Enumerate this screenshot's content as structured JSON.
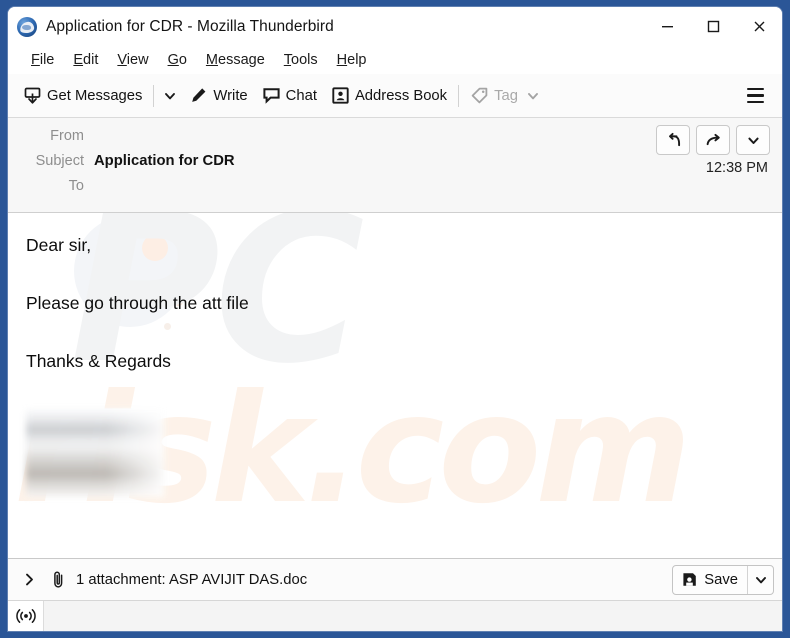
{
  "window": {
    "title": "Application for CDR - Mozilla Thunderbird",
    "app_icon": "thunderbird-icon",
    "controls": {
      "minimize": "minimize-icon",
      "maximize": "maximize-icon",
      "close": "close-icon"
    },
    "border_color": "#2b5697"
  },
  "menubar": [
    {
      "label": "File",
      "access_key": "F"
    },
    {
      "label": "Edit",
      "access_key": "E"
    },
    {
      "label": "View",
      "access_key": "V"
    },
    {
      "label": "Go",
      "access_key": "G"
    },
    {
      "label": "Message",
      "access_key": "M"
    },
    {
      "label": "Tools",
      "access_key": "T"
    },
    {
      "label": "Help",
      "access_key": "H"
    }
  ],
  "toolbar": {
    "get_messages": "Get Messages",
    "get_messages_icon": "inbox-download-icon",
    "get_messages_caret": "chevron-down-icon",
    "write": "Write",
    "write_icon": "pencil-icon",
    "chat": "Chat",
    "chat_icon": "speech-bubble-icon",
    "address_book": "Address Book",
    "address_book_icon": "contact-card-icon",
    "tag": "Tag",
    "tag_icon": "tag-icon",
    "tag_caret": "chevron-down-icon",
    "tag_disabled": true,
    "app_menu_icon": "hamburger-menu-icon"
  },
  "message_header": {
    "from_label": "From",
    "from_value": "",
    "subject_label": "Subject",
    "subject_value": "Application for CDR",
    "to_label": "To",
    "to_value": "",
    "time": "12:38 PM",
    "actions": {
      "reply": "reply-icon",
      "forward": "forward-icon",
      "more": "chevron-down-icon"
    }
  },
  "message_body": {
    "lines": [
      "Dear sir,",
      "Please go through the att file",
      "Thanks & Regards"
    ],
    "signature_image": "blurred-signature-image",
    "watermark_primary": "PC",
    "watermark_secondary": "risk.com"
  },
  "attachment_bar": {
    "expand_icon": "chevron-right-icon",
    "paperclip_icon": "paperclip-icon",
    "text": "1 attachment: ASP AVIJIT DAS.doc",
    "count": 1,
    "filename": "ASP AVIJIT DAS.doc",
    "save_label": "Save",
    "save_icon": "save-disk-icon",
    "save_caret": "chevron-down-icon"
  },
  "statusbar": {
    "icon": "broadcast-signal-icon",
    "text": ""
  }
}
